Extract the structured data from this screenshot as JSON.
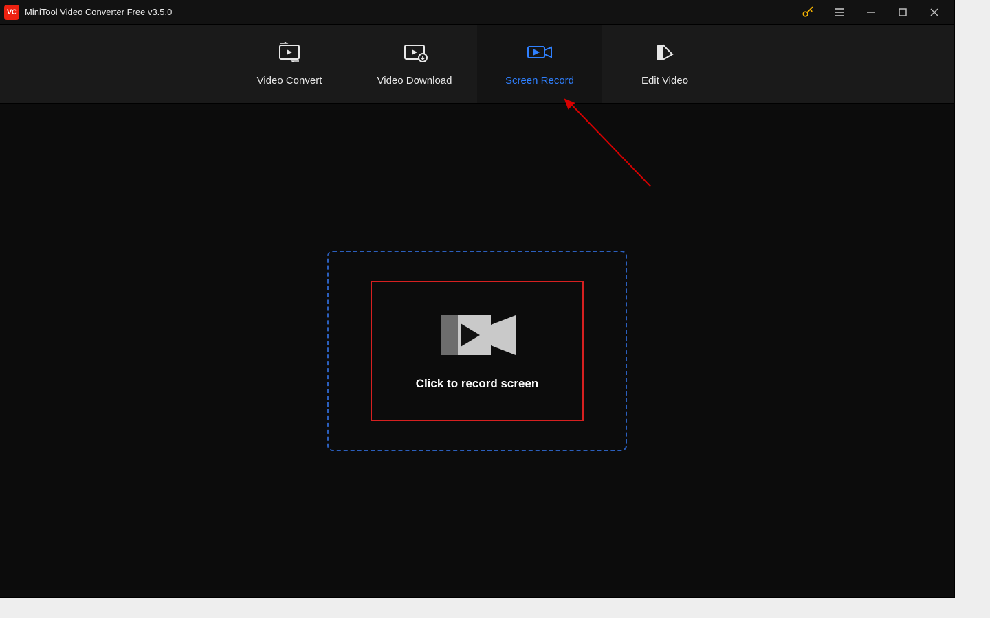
{
  "app": {
    "title": "MiniTool Video Converter Free v3.5.0",
    "logo_text": "VC"
  },
  "titlebar": {
    "key_icon": "key-icon",
    "menu_icon": "hamburger-icon",
    "minimize_icon": "minimize-icon",
    "maximize_icon": "maximize-icon",
    "close_icon": "close-icon"
  },
  "nav": {
    "tabs": [
      {
        "id": "video-convert",
        "label": "Video Convert",
        "icon": "convert-icon",
        "active": false
      },
      {
        "id": "video-download",
        "label": "Video Download",
        "icon": "download-icon",
        "active": false
      },
      {
        "id": "screen-record",
        "label": "Screen Record",
        "icon": "record-icon",
        "active": true
      },
      {
        "id": "edit-video",
        "label": "Edit Video",
        "icon": "edit-icon",
        "active": false
      }
    ]
  },
  "main": {
    "record_button_label": "Click to record screen"
  },
  "annotation": {
    "arrow_color": "#d60000",
    "highlight_box_color": "#d62020",
    "dashed_box_color": "#2b5fbd",
    "accent_color": "#2f80ff"
  }
}
